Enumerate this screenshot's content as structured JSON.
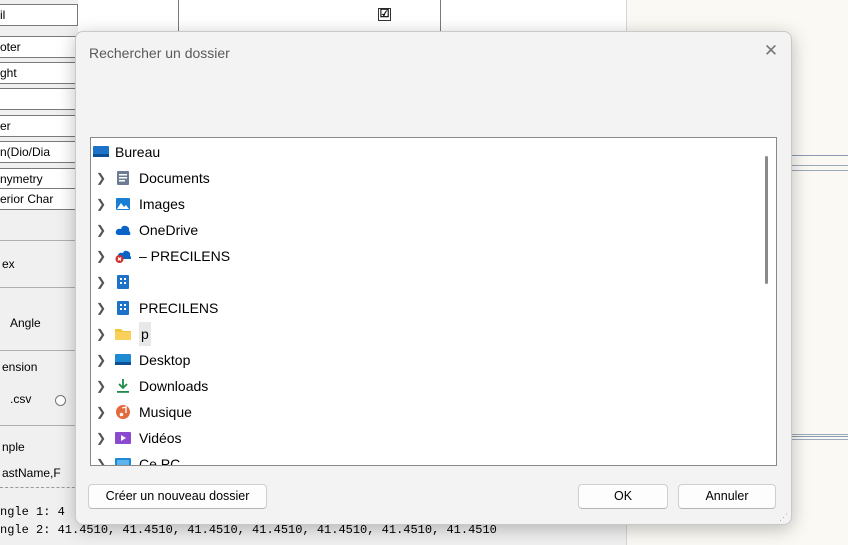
{
  "background_app": {
    "left_rows": [
      "il",
      "oter",
      "ght",
      "",
      "er",
      "n(Dio/Dia",
      "nymetry",
      "erior Char"
    ],
    "left_labels": {
      "index": "ex",
      "angle": "Angle",
      "extension": "ension",
      "csv": ".csv",
      "example": "nple",
      "header_row": "astName,F",
      "angle1": "ngle  1:  4",
      "angle2": "ngle  2:  41.4510,  41.4510,  41.4510,  41.4510,  41.4510,  41.4510,  41.4510"
    },
    "checkbox_mark": "☑"
  },
  "dialog": {
    "title": "Rechercher un dossier",
    "close_glyph": "✕",
    "tree": [
      {
        "label": "Bureau",
        "icon": "desktop-icon",
        "color": "#1e73c8",
        "expandable": false,
        "indent": 0
      },
      {
        "label": "Documents",
        "icon": "document-icon",
        "color": "#6d7c93",
        "expandable": true,
        "indent": 1
      },
      {
        "label": "Images",
        "icon": "image-icon",
        "color": "#1a7fd4",
        "expandable": true,
        "indent": 1
      },
      {
        "label": "OneDrive",
        "icon": "cloud-icon",
        "color": "#0a64c8",
        "expandable": true,
        "indent": 1
      },
      {
        "label": "– PRECILENS",
        "icon": "cloud-error-icon",
        "color": "#0a64c8",
        "expandable": true,
        "indent": 1
      },
      {
        "label": "",
        "icon": "building-icon",
        "color": "#1e73c8",
        "expandable": true,
        "indent": 1
      },
      {
        "label": "PRECILENS",
        "icon": "building-icon",
        "color": "#1e73c8",
        "expandable": true,
        "indent": 1
      },
      {
        "label": "p",
        "icon": "folder-icon",
        "color": "#f3c43d",
        "expandable": true,
        "indent": 1,
        "selected": true
      },
      {
        "label": "Desktop",
        "icon": "desktop-icon",
        "color": "#1e8ad4",
        "expandable": true,
        "indent": 1
      },
      {
        "label": "Downloads",
        "icon": "download-icon",
        "color": "#1f8a4c",
        "expandable": true,
        "indent": 1
      },
      {
        "label": "Musique",
        "icon": "music-icon",
        "color": "#e26a3c",
        "expandable": true,
        "indent": 1
      },
      {
        "label": "Vidéos",
        "icon": "video-icon",
        "color": "#8a4bd1",
        "expandable": true,
        "indent": 1
      },
      {
        "label": "Ce PC",
        "icon": "computer-icon",
        "color": "#1e8ad4",
        "expandable": true,
        "indent": 1
      }
    ],
    "buttons": {
      "new_folder": "Créer un nouveau dossier",
      "ok": "OK",
      "cancel": "Annuler"
    }
  }
}
